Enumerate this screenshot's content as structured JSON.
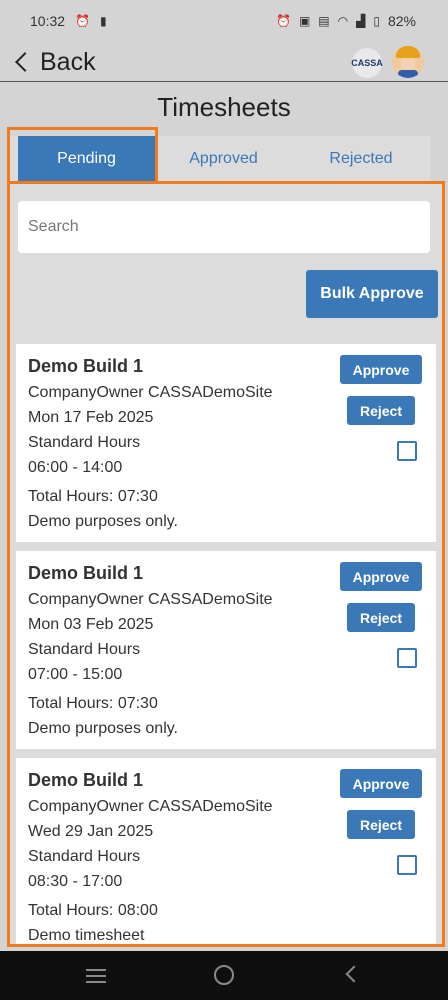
{
  "status_bar": {
    "time": "10:32",
    "battery": "82%",
    "left_icons": [
      "alarm-icon",
      "sim-icon"
    ],
    "right_icons": [
      "alarm-icon",
      "cast-icon",
      "volte-icon",
      "wifi-icon",
      "signal-icon",
      "battery-icon"
    ]
  },
  "header": {
    "back_label": "Back",
    "title": "Timesheets",
    "logo_text": "CASSA"
  },
  "tabs": [
    {
      "label": "Pending",
      "active": true
    },
    {
      "label": "Approved",
      "active": false
    },
    {
      "label": "Rejected",
      "active": false
    }
  ],
  "search": {
    "placeholder": "Search"
  },
  "bulk_approve_label": "Bulk Approve",
  "card_actions": {
    "approve": "Approve",
    "reject": "Reject"
  },
  "timesheets": [
    {
      "title": "Demo Build 1",
      "site": "CompanyOwner CASSADemoSite",
      "date": "Mon 17 Feb 2025",
      "type": "Standard Hours",
      "time_range": "06:00 - 14:00",
      "total": "Total Hours: 07:30",
      "note": "Demo purposes only."
    },
    {
      "title": "Demo Build 1",
      "site": "CompanyOwner CASSADemoSite",
      "date": "Mon 03 Feb 2025",
      "type": "Standard Hours",
      "time_range": "07:00 - 15:00",
      "total": "Total Hours: 07:30",
      "note": "Demo purposes only."
    },
    {
      "title": "Demo Build 1",
      "site": "CompanyOwner CASSADemoSite",
      "date": "Wed 29 Jan 2025",
      "type": "Standard Hours",
      "time_range": "08:30 - 17:00",
      "total": "Total Hours: 08:00",
      "note": "Demo timesheet"
    }
  ],
  "colors": {
    "accent": "#3a78b8",
    "highlight": "#f07b1f",
    "background": "#d4d4d4"
  }
}
